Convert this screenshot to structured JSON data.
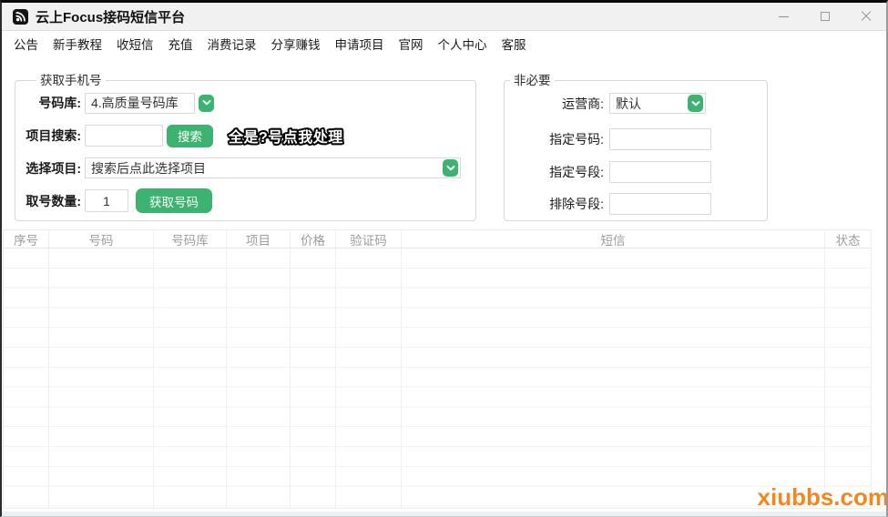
{
  "window": {
    "title": "云上Focus接码短信平台"
  },
  "icons": {
    "app_logo": "rss-icon",
    "minimize": "minimize-icon",
    "maximize": "maximize-icon",
    "close": "close-icon",
    "combo_arrow": "chevron-down-icon"
  },
  "menu": {
    "items": [
      "公告",
      "新手教程",
      "收短信",
      "充值",
      "消费记录",
      "分享赚钱",
      "申请项目",
      "官网",
      "个人中心",
      "客服"
    ]
  },
  "get_number_panel": {
    "legend": "获取手机号",
    "library_label": "号码库:",
    "library_value": "4.高质量号码库",
    "search_label": "项目搜索:",
    "search_value": "",
    "search_button": "搜索",
    "notice": "全是?号点我处理",
    "project_label": "选择项目:",
    "project_value": "搜索后点此选择项目",
    "quantity_label": "取号数量:",
    "quantity_value": "1",
    "fetch_button": "获取号码"
  },
  "optional_panel": {
    "legend": "非必要",
    "operator_label": "运营商:",
    "operator_value": "默认",
    "fields": [
      {
        "label": "指定号码:",
        "value": ""
      },
      {
        "label": "指定号段:",
        "value": ""
      },
      {
        "label": "排除号段:",
        "value": ""
      }
    ]
  },
  "table": {
    "columns": [
      "序号",
      "号码",
      "号码库",
      "项目",
      "价格",
      "验证码",
      "短信",
      "状态"
    ],
    "rows": []
  },
  "watermark": "xiubbs.com",
  "colors": {
    "accent_green": "#3cb371",
    "watermark_orange": "#f5861f"
  }
}
